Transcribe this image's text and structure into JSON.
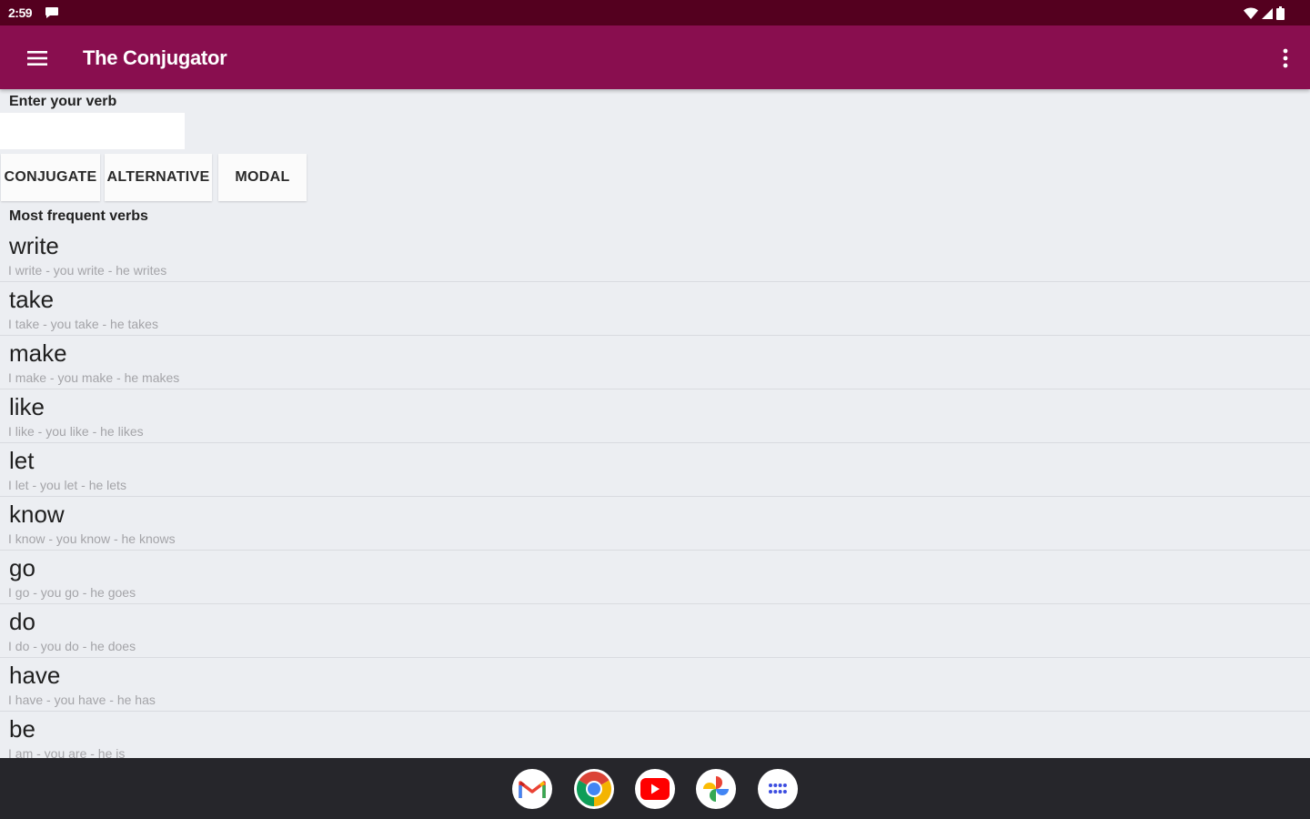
{
  "status_bar": {
    "time": "2:59"
  },
  "app_bar": {
    "title": "The Conjugator"
  },
  "form": {
    "label": "Enter your verb",
    "input_value": "",
    "buttons": {
      "conjugate": "CONJUGATE",
      "alternative": "ALTERNATIVE",
      "modal": "MODAL"
    }
  },
  "list": {
    "title": "Most frequent verbs",
    "verbs": [
      {
        "name": "write",
        "forms": "I write - you write - he writes"
      },
      {
        "name": "take",
        "forms": "I take - you take - he takes"
      },
      {
        "name": "make",
        "forms": "I make - you make - he makes"
      },
      {
        "name": "like",
        "forms": "I like - you like - he likes"
      },
      {
        "name": "let",
        "forms": "I let - you let - he lets"
      },
      {
        "name": "know",
        "forms": "I know - you know - he knows"
      },
      {
        "name": "go",
        "forms": "I go - you go - he goes"
      },
      {
        "name": "do",
        "forms": "I do - you do - he does"
      },
      {
        "name": "have",
        "forms": "I have - you have - he has"
      },
      {
        "name": "be",
        "forms": "I am - you are - he is"
      }
    ]
  },
  "taskbar": {
    "apps": [
      "gmail-icon",
      "chrome-icon",
      "youtube-icon",
      "photos-icon",
      "app-launcher-icon"
    ]
  },
  "colors": {
    "status_bar": "#54001f",
    "app_bar": "#890e4f",
    "background": "#eceef2"
  }
}
